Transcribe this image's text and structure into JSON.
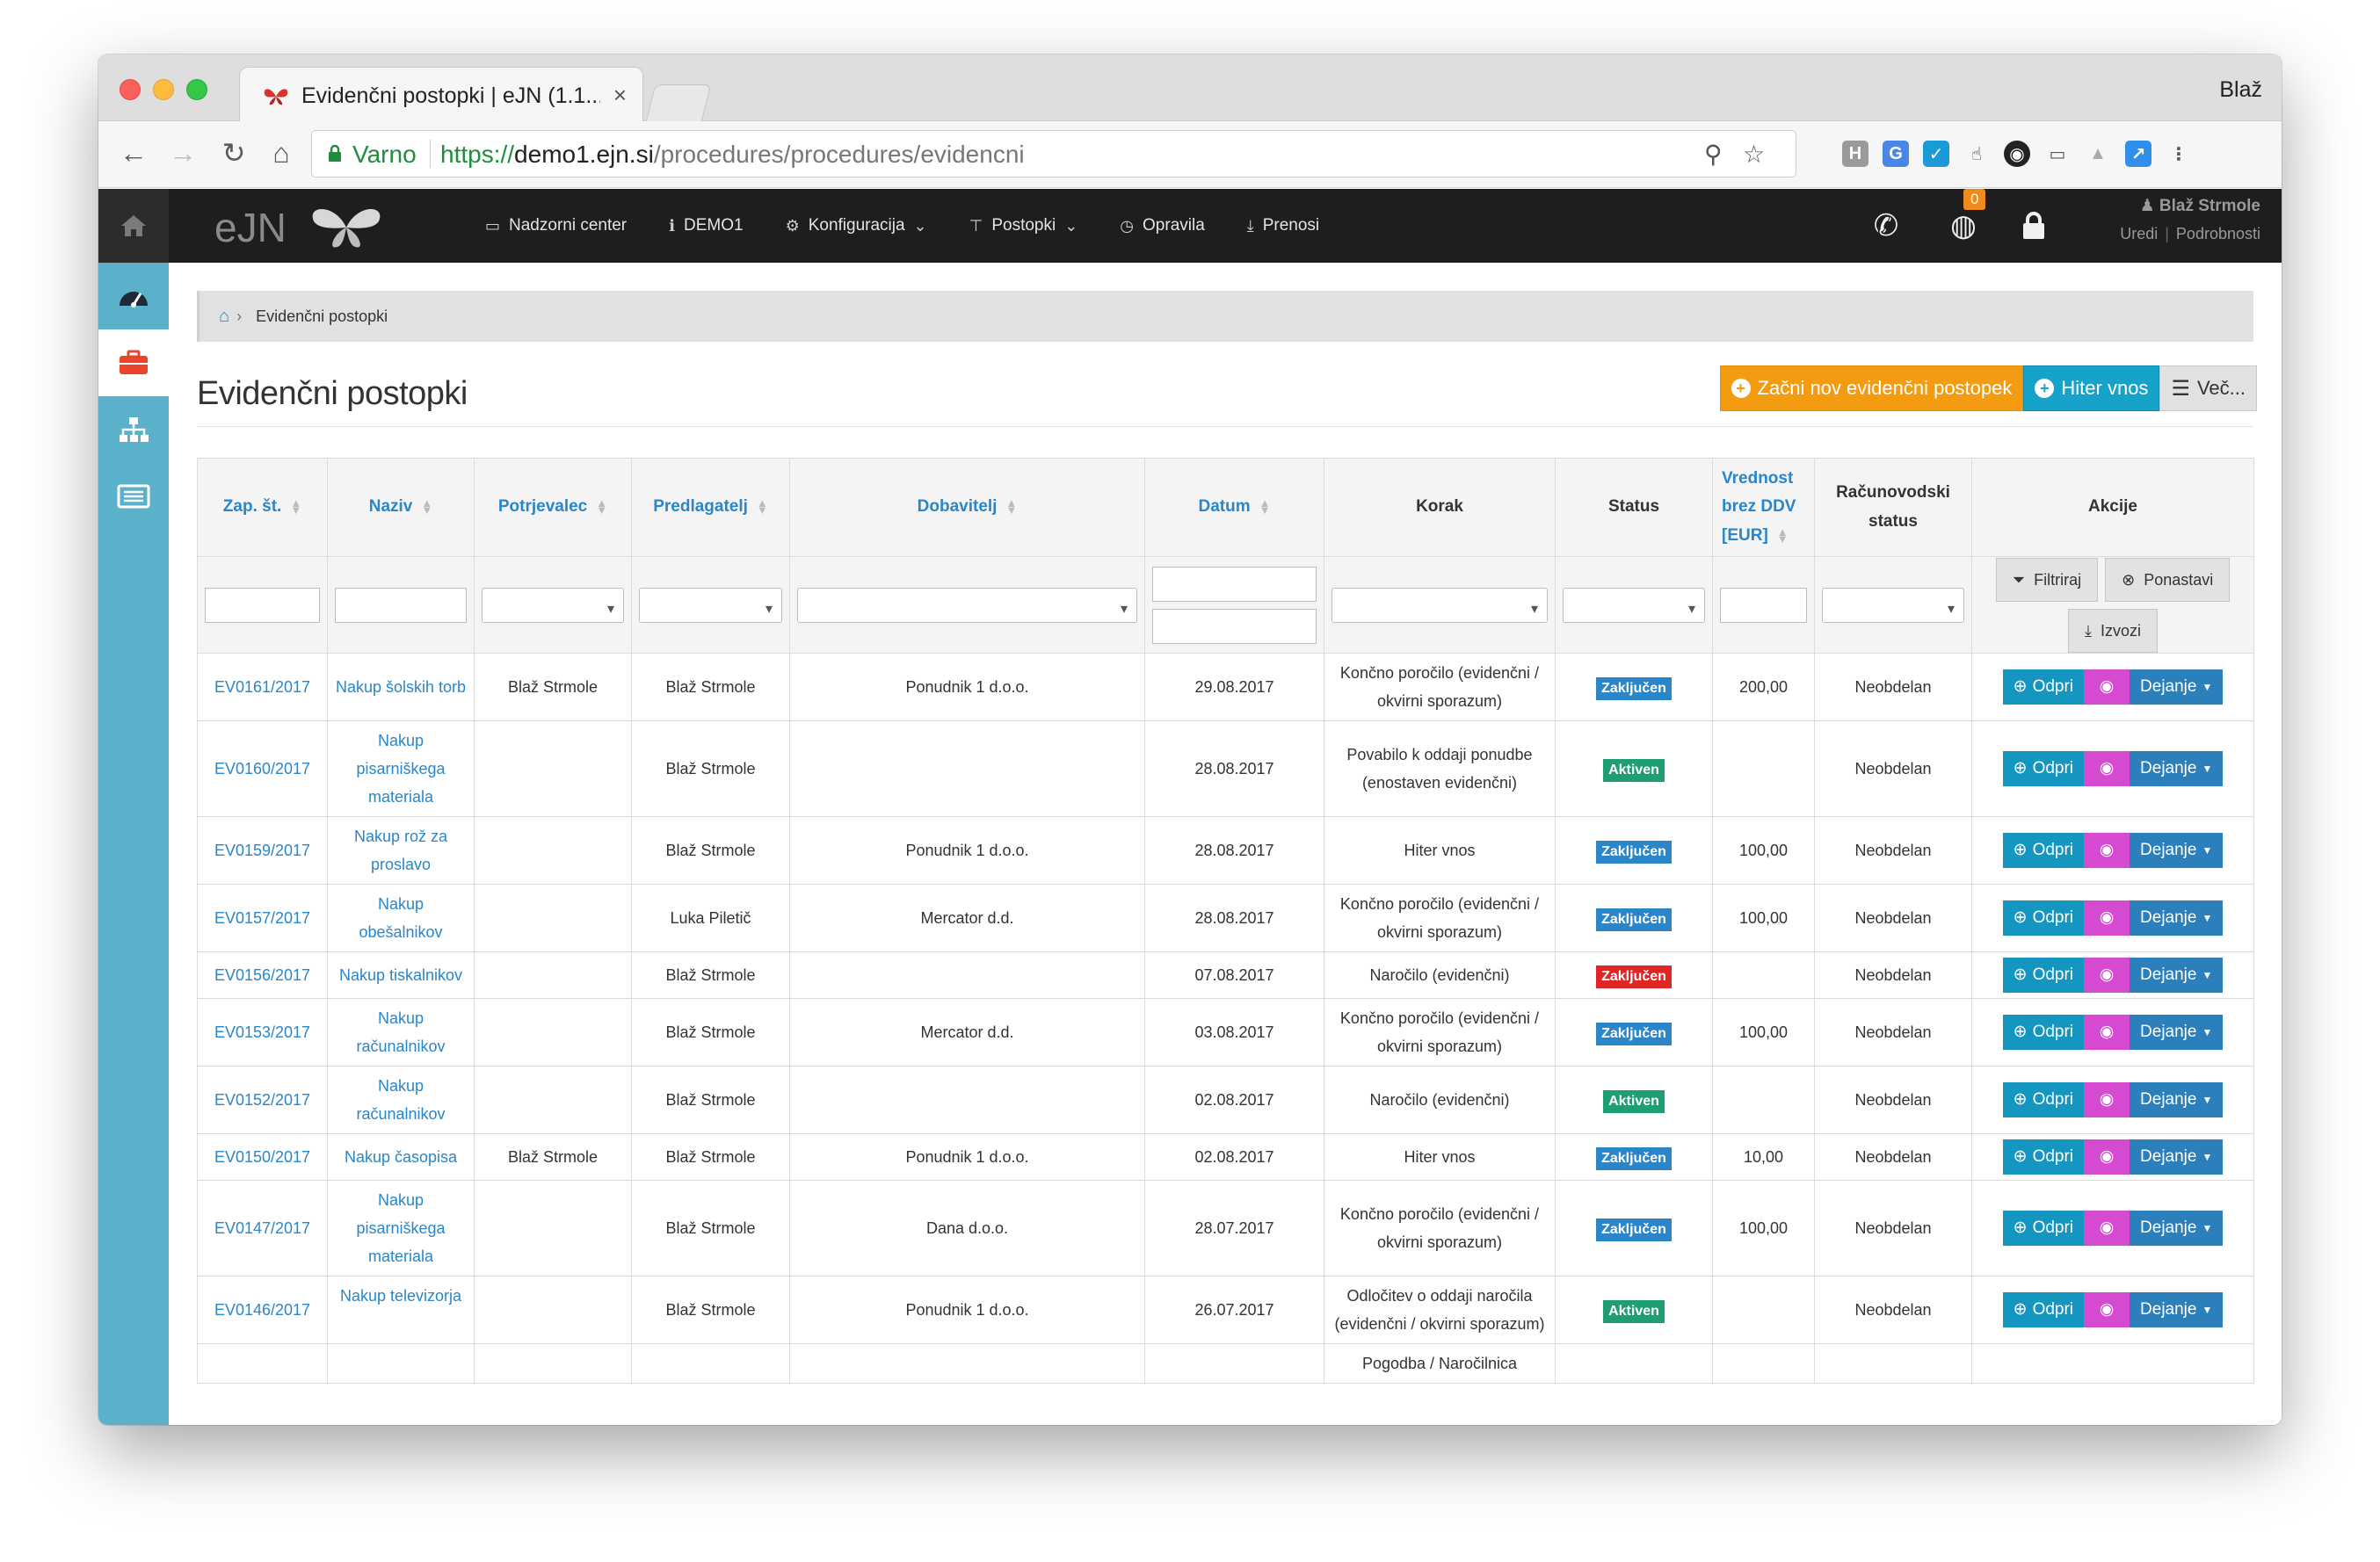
{
  "browser": {
    "tab_title": "Evidenčni postopki | eJN (1.1...",
    "profile": "Blaž",
    "secure_label": "Varno",
    "url_scheme": "https://",
    "url_host": "demo1.ejn.si",
    "url_path": "/procedures/procedures/evidencni"
  },
  "app": {
    "logo_text": "eJN",
    "menu": [
      {
        "label": "Nadzorni center",
        "icon": "monitor-icon"
      },
      {
        "label": "DEMO1",
        "icon": "info-icon"
      },
      {
        "label": "Konfiguracija",
        "icon": "cogs-icon"
      },
      {
        "label": "Postopki",
        "icon": "sitemap-icon"
      },
      {
        "label": "Opravila",
        "icon": "clock-icon"
      },
      {
        "label": "Prenosi",
        "icon": "download-icon"
      }
    ],
    "notifications_count": "0",
    "user": {
      "name": "Blaž Strmole",
      "edit": "Uredi",
      "details": "Podrobnosti"
    }
  },
  "breadcrumb": {
    "current": "Evidenčni postopki"
  },
  "page": {
    "title": "Evidenčni postopki",
    "btn_new": "Začni nov evidenčni postopek",
    "btn_quick": "Hiter vnos",
    "btn_more": "Več..."
  },
  "table": {
    "headers": {
      "zap": "Zap. št.",
      "naziv": "Naziv",
      "potrjevalec": "Potrjevalec",
      "predlagatelj": "Predlagatelj",
      "dobavitelj": "Dobavitelj",
      "datum": "Datum",
      "korak": "Korak",
      "status": "Status",
      "vrednost": "Vrednost brez DDV [EUR]",
      "racunovodski": "Računovodski status",
      "akcije": "Akcije"
    },
    "filter_buttons": {
      "filter": "Filtriraj",
      "reset": "Ponastavi",
      "export": "Izvozi"
    },
    "action_labels": {
      "open": "Odpri",
      "do": "Dejanje"
    },
    "rows": [
      {
        "zap": "EV0161/2017",
        "naziv": "Nakup šolskih torb",
        "potrjevalec": "Blaž Strmole",
        "predlagatelj": "Blaž Strmole",
        "dobavitelj": "Ponudnik 1 d.o.o.",
        "datum": "29.08.2017",
        "korak": "Končno poročilo (evidenčni / okvirni sporazum)",
        "status": "Zaključen",
        "status_color": "#2a86c8",
        "vrednost": "200,00",
        "racunovodski": "Neobdelan"
      },
      {
        "zap": "EV0160/2017",
        "naziv": "Nakup pisarniškega materiala",
        "potrjevalec": "",
        "predlagatelj": "Blaž Strmole",
        "dobavitelj": "",
        "datum": "28.08.2017",
        "korak": "Povabilo k oddaji ponudbe (enostaven evidenčni)",
        "status": "Aktiven",
        "status_color": "#1f9d74",
        "vrednost": "",
        "racunovodski": "Neobdelan"
      },
      {
        "zap": "EV0159/2017",
        "naziv": "Nakup rož za proslavo",
        "potrjevalec": "",
        "predlagatelj": "Blaž Strmole",
        "dobavitelj": "Ponudnik 1 d.o.o.",
        "datum": "28.08.2017",
        "korak": "Hiter vnos",
        "status": "Zaključen",
        "status_color": "#2a86c8",
        "vrednost": "100,00",
        "racunovodski": "Neobdelan"
      },
      {
        "zap": "EV0157/2017",
        "naziv": "Nakup obešalnikov",
        "potrjevalec": "",
        "predlagatelj": "Luka Piletič",
        "dobavitelj": "Mercator d.d.",
        "datum": "28.08.2017",
        "korak": "Končno poročilo (evidenčni / okvirni sporazum)",
        "status": "Zaključen",
        "status_color": "#2a86c8",
        "vrednost": "100,00",
        "racunovodski": "Neobdelan"
      },
      {
        "zap": "EV0156/2017",
        "naziv": "Nakup tiskalnikov",
        "potrjevalec": "",
        "predlagatelj": "Blaž Strmole",
        "dobavitelj": "",
        "datum": "07.08.2017",
        "korak": "Naročilo (evidenčni)",
        "status": "Zaključen",
        "status_color": "#e02525",
        "vrednost": "",
        "racunovodski": "Neobdelan"
      },
      {
        "zap": "EV0153/2017",
        "naziv": "Nakup računalnikov",
        "potrjevalec": "",
        "predlagatelj": "Blaž Strmole",
        "dobavitelj": "Mercator d.d.",
        "datum": "03.08.2017",
        "korak": "Končno poročilo (evidenčni / okvirni sporazum)",
        "status": "Zaključen",
        "status_color": "#2a86c8",
        "vrednost": "100,00",
        "racunovodski": "Neobdelan"
      },
      {
        "zap": "EV0152/2017",
        "naziv": "Nakup računalnikov",
        "potrjevalec": "",
        "predlagatelj": "Blaž Strmole",
        "dobavitelj": "",
        "datum": "02.08.2017",
        "korak": "Naročilo (evidenčni)",
        "status": "Aktiven",
        "status_color": "#1f9d74",
        "vrednost": "",
        "racunovodski": "Neobdelan"
      },
      {
        "zap": "EV0150/2017",
        "naziv": "Nakup časopisa",
        "potrjevalec": "Blaž Strmole",
        "predlagatelj": "Blaž Strmole",
        "dobavitelj": "Ponudnik 1 d.o.o.",
        "datum": "02.08.2017",
        "korak": "Hiter vnos",
        "status": "Zaključen",
        "status_color": "#2a86c8",
        "vrednost": "10,00",
        "racunovodski": "Neobdelan"
      },
      {
        "zap": "EV0147/2017",
        "naziv": "Nakup pisarniškega materiala",
        "potrjevalec": "",
        "predlagatelj": "Blaž Strmole",
        "dobavitelj": "Dana d.o.o.",
        "datum": "28.07.2017",
        "korak": "Končno poročilo (evidenčni / okvirni sporazum)",
        "status": "Zaključen",
        "status_color": "#2a86c8",
        "vrednost": "100,00",
        "racunovodski": "Neobdelan"
      },
      {
        "zap": "EV0146/2017",
        "naziv": "Nakup televizorja",
        "potrjevalec": "",
        "predlagatelj": "Blaž Strmole",
        "dobavitelj": "Ponudnik 1 d.o.o.",
        "datum": "26.07.2017",
        "korak": "Odločitev o oddaji naročila (evidenčni / okvirni sporazum)",
        "status": "Aktiven",
        "status_color": "#1f9d74",
        "vrednost": "",
        "racunovodski": "Neobdelan"
      },
      {
        "zap": "",
        "naziv": "",
        "potrjevalec": "",
        "predlagatelj": "",
        "dobavitelj": "",
        "datum": "",
        "korak": "Pogodba / Naročilnica",
        "status": "",
        "status_color": "#2a86c8",
        "vrednost": "",
        "racunovodski": ""
      }
    ]
  }
}
